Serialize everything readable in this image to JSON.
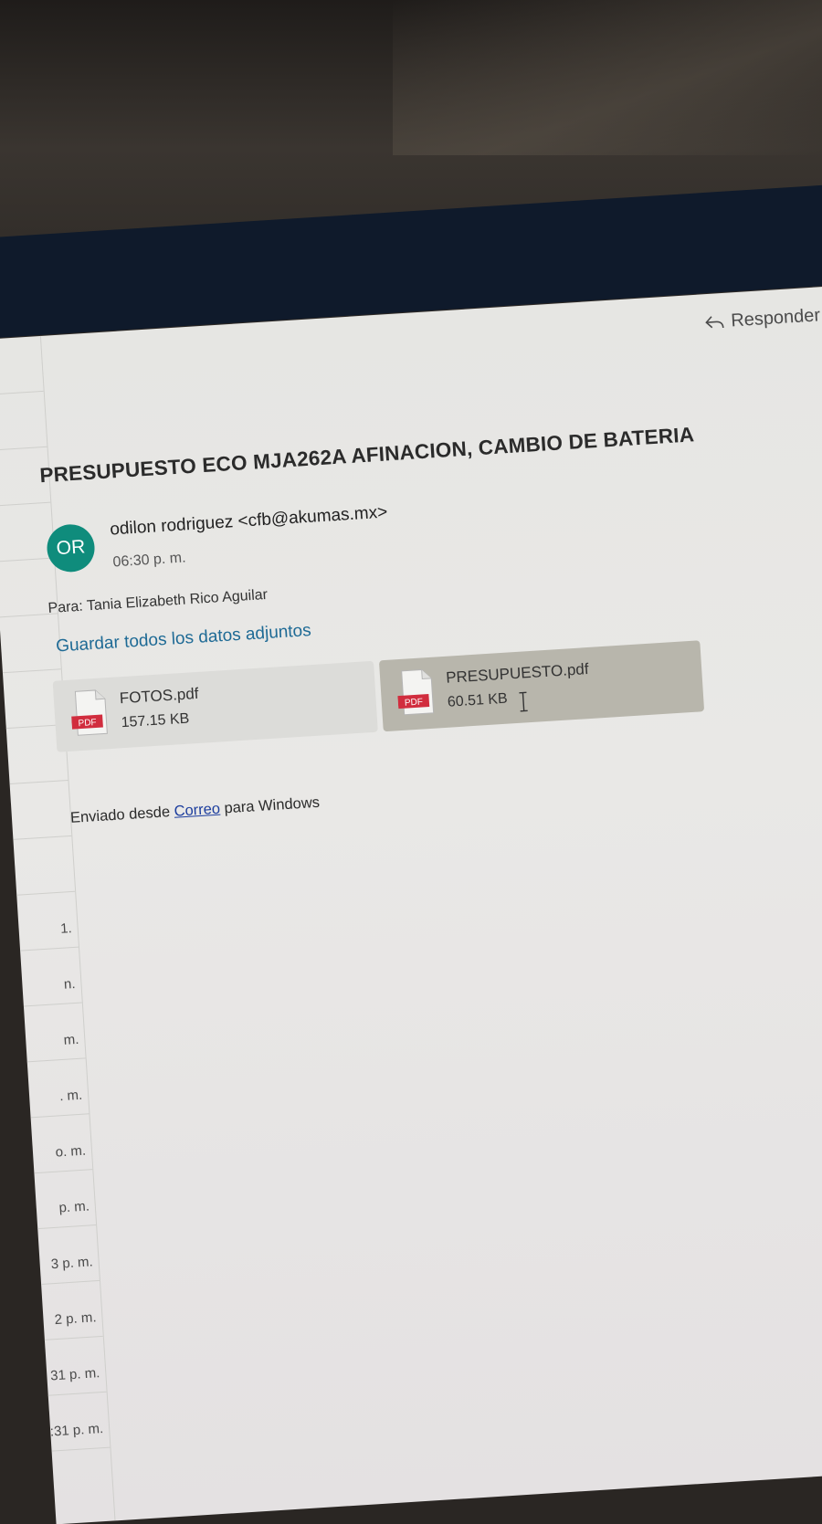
{
  "toolbar": {
    "reply_label": "Responder"
  },
  "message": {
    "subject": "PRESUPUESTO ECO MJA262A AFINACION, CAMBIO DE BATERIA",
    "avatar_initials": "OR",
    "avatar_color": "#0f8c7c",
    "sender": "odilon rodriguez <cfb@akumas.mx>",
    "time": "06:30 p. m.",
    "to_label": "Para:",
    "to_value": "Tania Elizabeth Rico Aguilar",
    "save_all_label": "Guardar todos los datos adjuntos",
    "link_color": "#1e6a95"
  },
  "attachments": [
    {
      "name": "FOTOS.pdf",
      "size": "157.15 KB",
      "badge": "PDF"
    },
    {
      "name": "PRESUPUESTO.pdf",
      "size": "60.51 KB",
      "badge": "PDF"
    }
  ],
  "signature": {
    "prefix": "Enviado desde ",
    "link": "Correo",
    "suffix": " para Windows"
  },
  "mail_list": {
    "times": [
      "",
      "",
      "",
      "",
      "",
      "",
      "",
      "",
      "",
      "",
      "1.",
      "n.",
      "m.",
      ". m.",
      "o. m.",
      "p. m.",
      "3 p. m.",
      "2 p. m.",
      "31 p. m.",
      ":31 p. m."
    ]
  }
}
